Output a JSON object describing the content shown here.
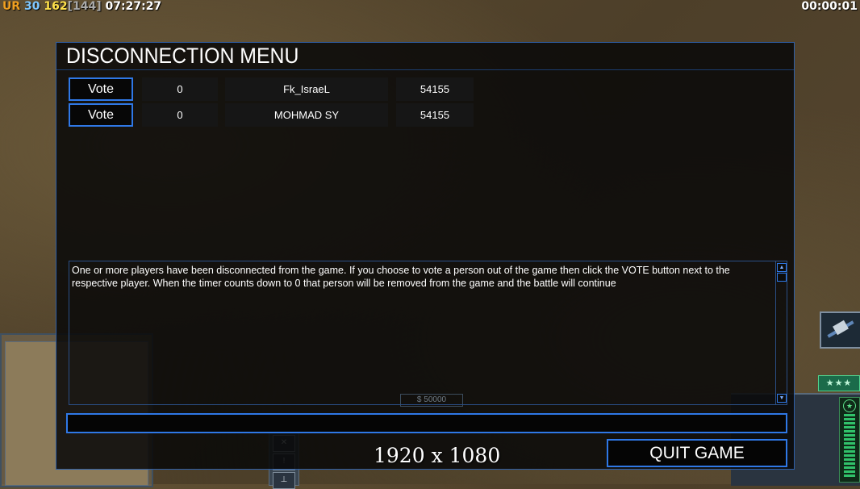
{
  "hud": {
    "tag": "UR",
    "fps": "30",
    "units": "162",
    "units_max": "[144]",
    "clock": "07:27:27",
    "game_timer": "00:00:01",
    "colors": {
      "tag": "#f0a020",
      "fps": "#7fc8ff",
      "units": "#ffe14a",
      "units_max": "#a9a9a9",
      "clock": "#ffffff"
    }
  },
  "background": {
    "money": "$ 50000",
    "rank_stars": "★★★",
    "meter_star": "★",
    "satellite_icon": "satellite-icon"
  },
  "dialog": {
    "title": "DISCONNECTION MENU",
    "players": [
      {
        "vote_label": "Vote",
        "votes": "0",
        "name": "Fk_IsraeL",
        "timer": "54155"
      },
      {
        "vote_label": "Vote",
        "votes": "0",
        "name": "MOHMAD SY",
        "timer": "54155"
      }
    ],
    "message": "One or more players have been disconnected from the game. If you choose to vote a person out of the game then click the VOTE button next to the respective player. When the timer counts down to 0 that person will be removed from the game and the battle will continue",
    "chat_value": "",
    "quit_label": "QUIT GAME",
    "scroll_up": "▲",
    "scroll_down": "▼"
  },
  "overlay": {
    "resolution": "1920 x 1080"
  },
  "colors": {
    "accent": "#2f78e6",
    "dialog_border": "#2e5fa8"
  }
}
